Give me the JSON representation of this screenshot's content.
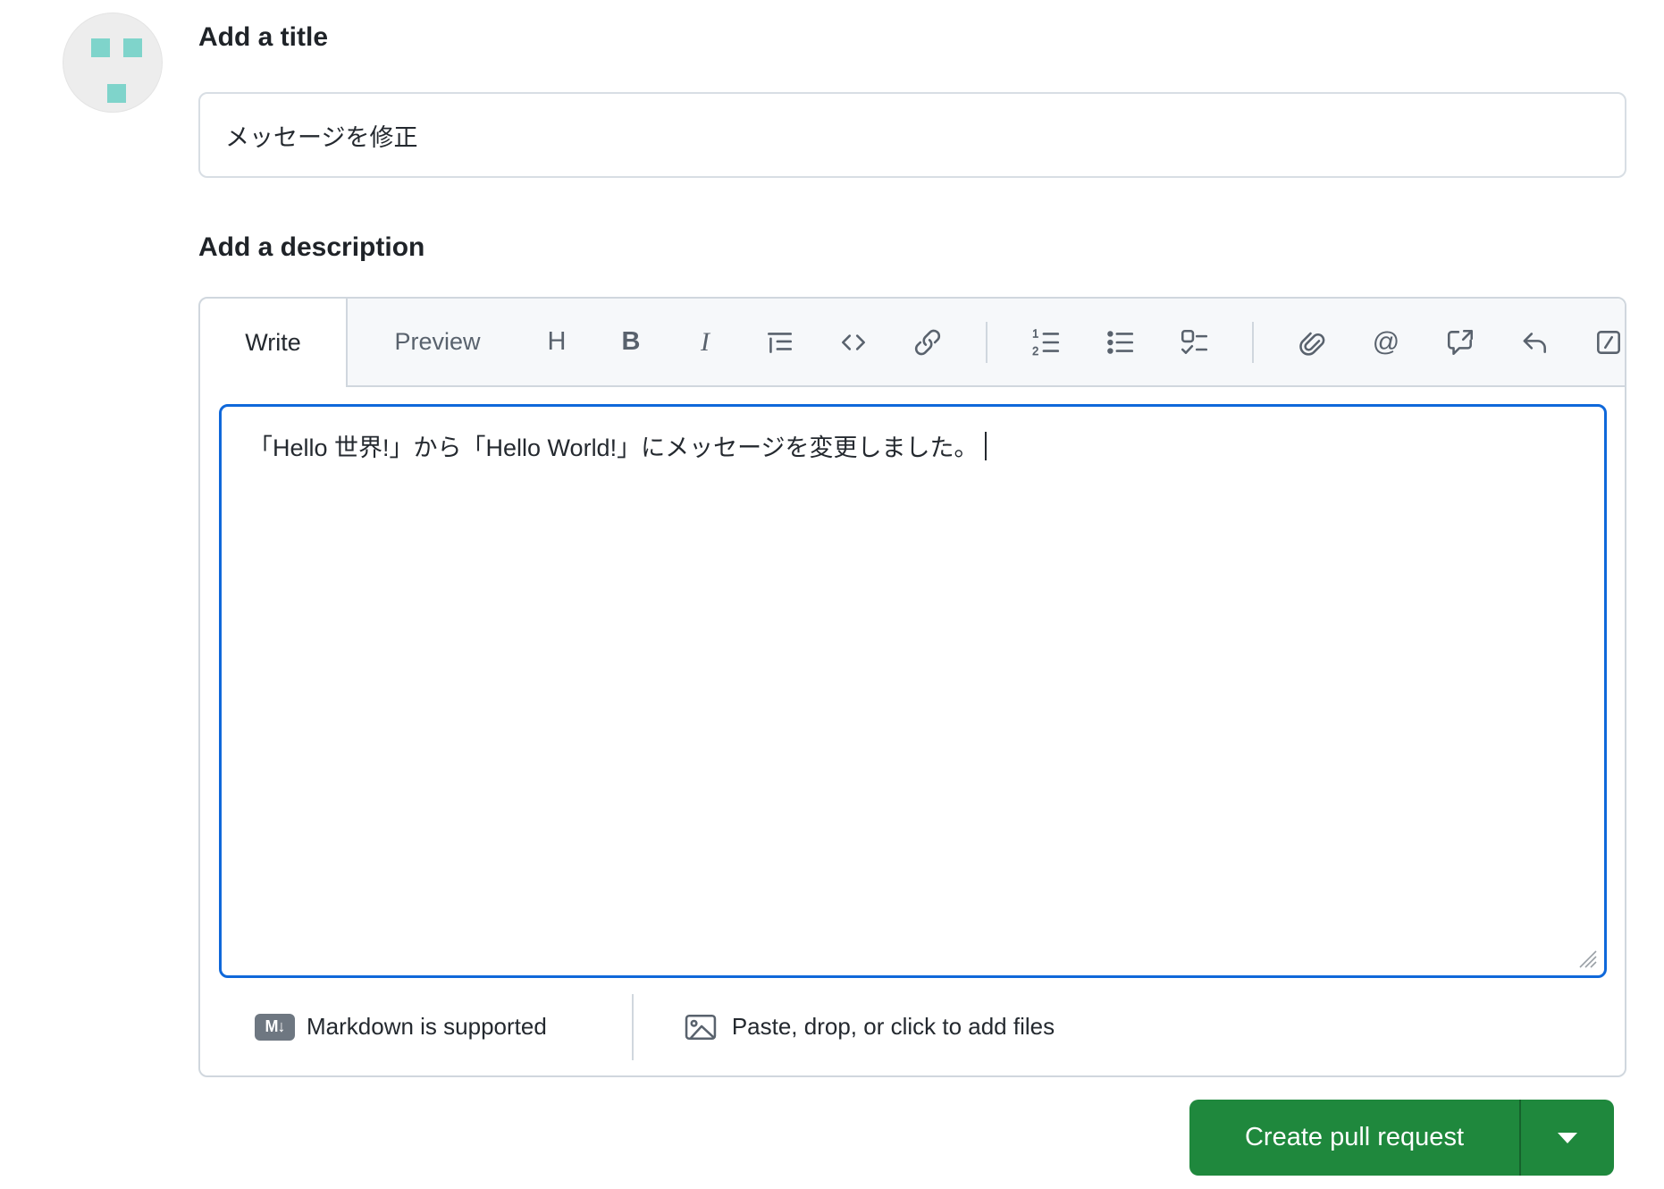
{
  "title_section": {
    "heading": "Add a title",
    "value": "メッセージを修正"
  },
  "description_section": {
    "heading": "Add a description",
    "tabs": [
      {
        "label": "Write",
        "active": true
      },
      {
        "label": "Preview",
        "active": false
      }
    ],
    "toolbar": {
      "heading_glyph": "H",
      "bold_glyph": "B",
      "italic_glyph": "I",
      "mention_glyph": "@",
      "icons": [
        "heading",
        "bold",
        "italic",
        "quote",
        "code",
        "link",
        "numbered-list",
        "unordered-list",
        "task-list",
        "attach-file",
        "mention",
        "cross-reference",
        "reply",
        "slash-commands"
      ]
    },
    "value": "「Hello 世界!」から「Hello World!」にメッセージを変更しました。",
    "footer": {
      "markdown_badge": "M↓",
      "markdown_note": "Markdown is supported",
      "attach_note": "Paste, drop, or click to add files"
    }
  },
  "actions": {
    "create_label": "Create pull request"
  },
  "colors": {
    "focus_blue": "#0f68da",
    "button_green": "#1f883d",
    "avatar_teal": "#7fd4cb",
    "border_gray": "#d0d7de",
    "icon_gray": "#59626d",
    "header_bg": "#f6f8fa",
    "text_dark": "#24292f"
  }
}
